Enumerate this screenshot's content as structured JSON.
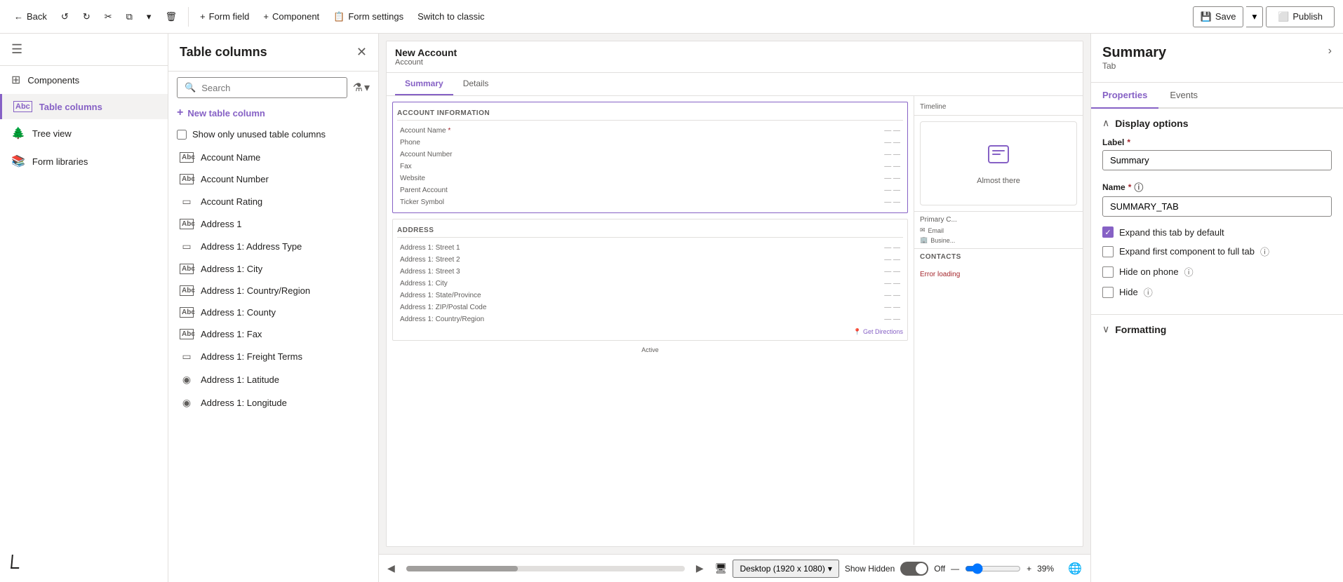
{
  "toolbar": {
    "back_label": "Back",
    "form_field_label": "Form field",
    "component_label": "Component",
    "form_settings_label": "Form settings",
    "switch_classic_label": "Switch to classic",
    "save_label": "Save",
    "publish_label": "Publish"
  },
  "left_nav": {
    "items": [
      {
        "id": "components",
        "label": "Components",
        "icon": "⊞"
      },
      {
        "id": "table-columns",
        "label": "Table columns",
        "icon": "Abc",
        "active": true
      },
      {
        "id": "tree-view",
        "label": "Tree view",
        "icon": "🌳"
      },
      {
        "id": "form-libraries",
        "label": "Form libraries",
        "icon": "📚"
      }
    ]
  },
  "columns_panel": {
    "title": "Table columns",
    "search_placeholder": "Search",
    "new_column_label": "New table column",
    "show_unused_label": "Show only unused table columns",
    "columns": [
      {
        "name": "Account Name",
        "icon": "Abc"
      },
      {
        "name": "Account Number",
        "icon": "Abc"
      },
      {
        "name": "Account Rating",
        "icon": "▭"
      },
      {
        "name": "Address 1",
        "icon": "Abc"
      },
      {
        "name": "Address 1: Address Type",
        "icon": "▭"
      },
      {
        "name": "Address 1: City",
        "icon": "Abc"
      },
      {
        "name": "Address 1: Country/Region",
        "icon": "Abc"
      },
      {
        "name": "Address 1: County",
        "icon": "Abc"
      },
      {
        "name": "Address 1: Fax",
        "icon": "Abc"
      },
      {
        "name": "Address 1: Freight Terms",
        "icon": "▭"
      },
      {
        "name": "Address 1: Latitude",
        "icon": "◉"
      },
      {
        "name": "Address 1: Longitude",
        "icon": "◉"
      }
    ]
  },
  "form_preview": {
    "title": "New Account",
    "subtitle": "Account",
    "tabs": [
      "Summary",
      "Details"
    ],
    "active_tab": "Summary",
    "account_section_title": "ACCOUNT INFORMATION",
    "account_fields": [
      {
        "label": "Account Name",
        "required": true
      },
      {
        "label": "Phone"
      },
      {
        "label": "Account Number"
      },
      {
        "label": "Fax"
      },
      {
        "label": "Website"
      },
      {
        "label": "Parent Account"
      },
      {
        "label": "Ticker Symbol"
      }
    ],
    "address_section_title": "ADDRESS",
    "address_fields": [
      {
        "label": "Address 1: Street 1"
      },
      {
        "label": "Address 1: Street 2"
      },
      {
        "label": "Address 1: Street 3"
      },
      {
        "label": "Address 1: City"
      },
      {
        "label": "Address 1: State/Province"
      },
      {
        "label": "Address 1: ZIP/Postal Code"
      },
      {
        "label": "Address 1: Country/Region"
      }
    ],
    "timeline_label": "Timeline",
    "almost_there_label": "Almost there",
    "error_loading_label": "Error loading",
    "get_directions_label": "Get Directions",
    "contacts_label": "CONTACTS",
    "active_label": "Active",
    "status_label": "Active"
  },
  "bottom_bar": {
    "device_label": "Desktop (1920 x 1080)",
    "show_hidden_label": "Show Hidden",
    "toggle_state": "Off",
    "zoom_label": "39%"
  },
  "right_panel": {
    "title": "Summary",
    "subtitle": "Tab",
    "tabs": [
      "Properties",
      "Events"
    ],
    "active_tab": "Properties",
    "display_options_title": "Display options",
    "label_field_label": "Label",
    "label_required": true,
    "label_value": "Summary",
    "name_field_label": "Name",
    "name_required": true,
    "name_value": "SUMMARY_TAB",
    "expand_tab_label": "Expand this tab by default",
    "expand_tab_checked": true,
    "expand_first_label": "Expand first component to full tab",
    "expand_first_checked": false,
    "hide_on_phone_label": "Hide on phone",
    "hide_on_phone_checked": false,
    "hide_label": "Hide",
    "hide_checked": false,
    "formatting_title": "Formatting"
  }
}
